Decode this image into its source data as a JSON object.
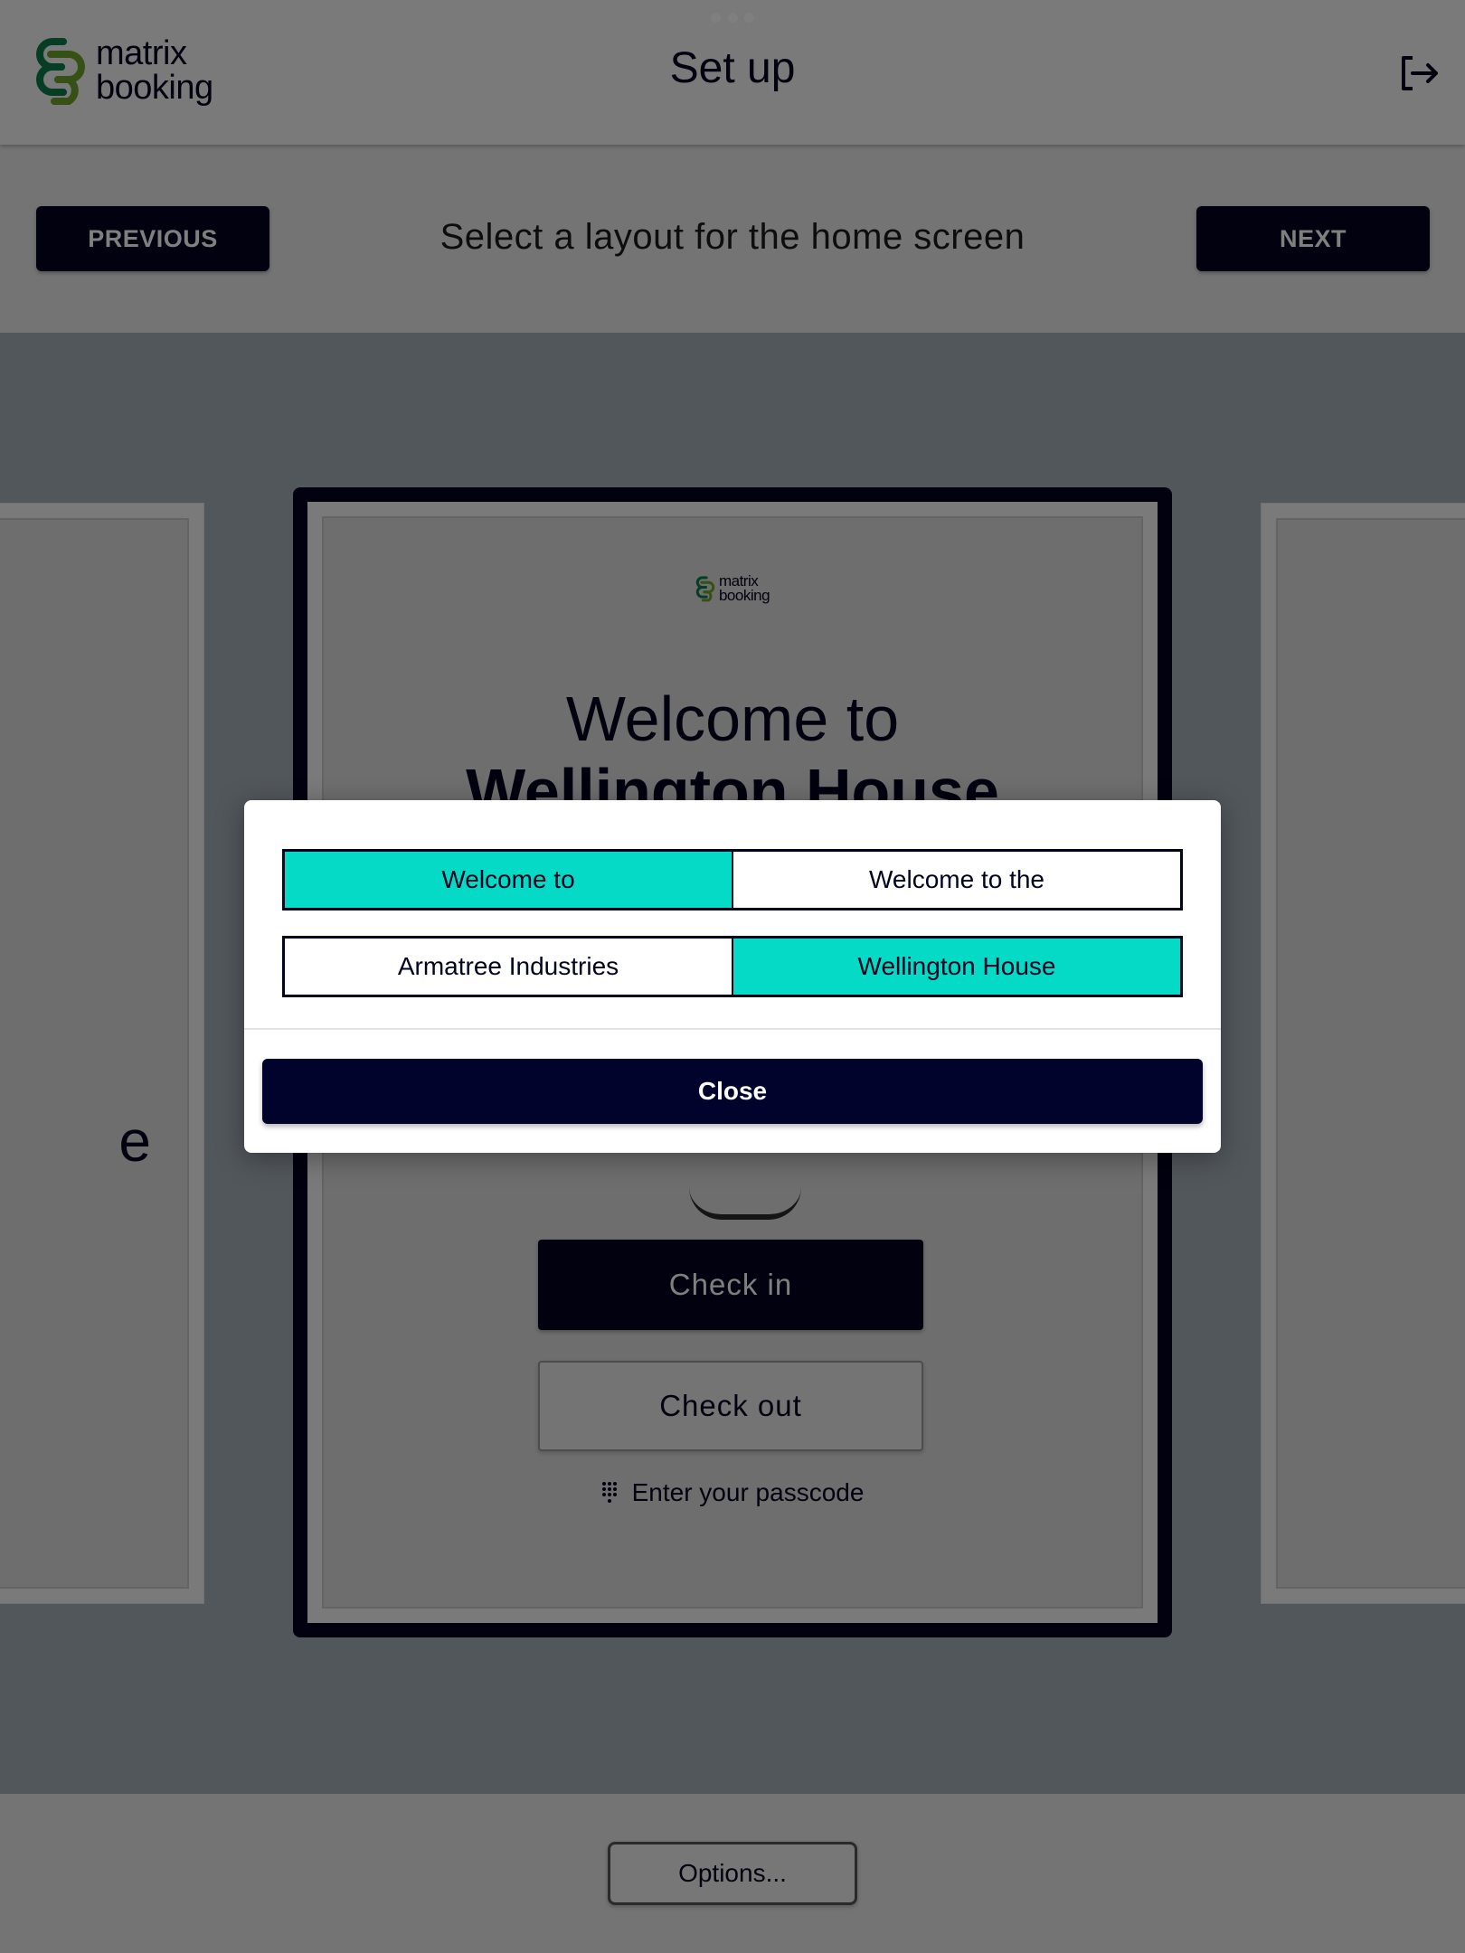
{
  "header": {
    "logo_line1": "matrix",
    "logo_line2": "booking",
    "title": "Set up",
    "logout_icon": "logout-icon",
    "multitask_icon": "more-dots-icon"
  },
  "stepbar": {
    "previous_label": "PREVIOUS",
    "next_label": "NEXT",
    "title": "Select a layout for the home screen"
  },
  "preview": {
    "logo_line1": "matrix",
    "logo_line2": "booking",
    "welcome_line": "Welcome to",
    "welcome_name": "Wellington House",
    "checkin_label": "Check in",
    "checkout_label": "Check out",
    "passcode_label": "Enter your passcode",
    "passcode_icon": "keypad-icon",
    "left_card_partial_text": "e"
  },
  "bottombar": {
    "options_label": "Options..."
  },
  "modal": {
    "greeting_options": [
      {
        "label": "Welcome to",
        "selected": true
      },
      {
        "label": "Welcome to the",
        "selected": false
      }
    ],
    "name_options": [
      {
        "label": "Armatree Industries",
        "selected": false
      },
      {
        "label": "Wellington House",
        "selected": true
      }
    ],
    "close_label": "Close"
  },
  "colors": {
    "primary_navy": "#02031e",
    "selected_teal": "#04dac6",
    "logo_green_dark": "#0a7a4a",
    "logo_green_light": "#6fa12a"
  }
}
